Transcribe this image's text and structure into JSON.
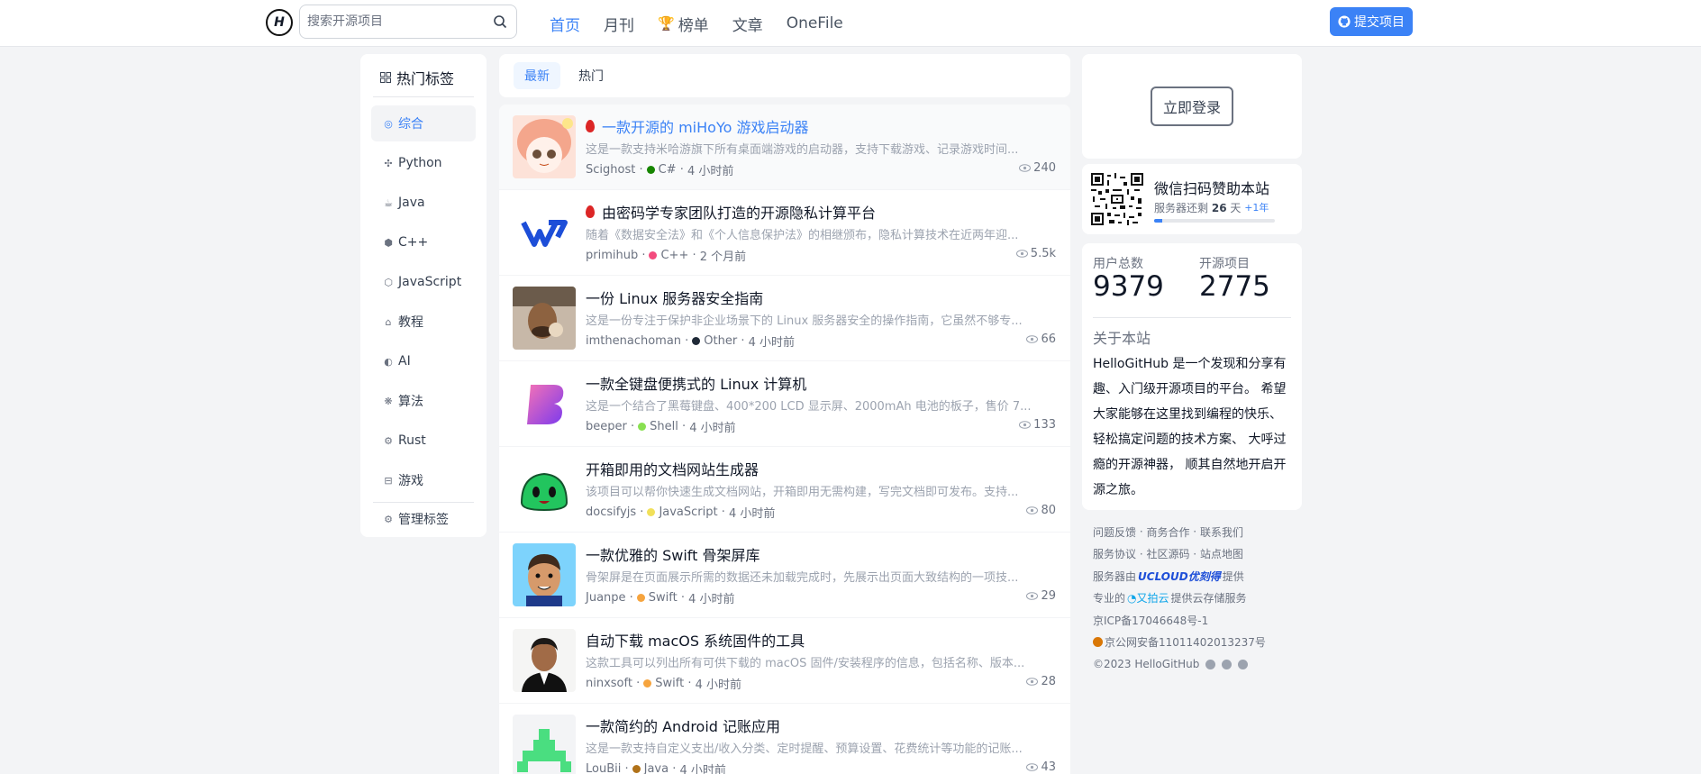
{
  "header": {
    "logo_text": "H",
    "search_placeholder": "搜索开源项目",
    "nav": [
      {
        "label": "首页"
      },
      {
        "label": "月刊"
      },
      {
        "label": "榜单"
      },
      {
        "label": "文章"
      },
      {
        "label": "OneFile"
      }
    ],
    "submit_label": "提交项目"
  },
  "sidebar": {
    "title": "热门标签",
    "tags": [
      {
        "label": "综合",
        "icon": "compass-icon"
      },
      {
        "label": "Python",
        "icon": "python-icon"
      },
      {
        "label": "Java",
        "icon": "java-icon"
      },
      {
        "label": "C++",
        "icon": "cpp-icon"
      },
      {
        "label": "JavaScript",
        "icon": "javascript-icon"
      },
      {
        "label": "教程",
        "icon": "graduation-cap-icon"
      },
      {
        "label": "AI",
        "icon": "ai-icon"
      },
      {
        "label": "算法",
        "icon": "algorithm-icon"
      },
      {
        "label": "Rust",
        "icon": "rust-icon"
      },
      {
        "label": "游戏",
        "icon": "gamepad-icon"
      }
    ],
    "manage_label": "管理标签"
  },
  "tabs": [
    {
      "label": "最新"
    },
    {
      "label": "热门"
    }
  ],
  "projects": [
    {
      "title": "一款开源的 miHoYo 游戏启动器",
      "hot": true,
      "desc": "这是一款支持米哈游旗下所有桌面端游戏的启动器，支持下载游戏、记录游戏时间...",
      "author": "Scighost",
      "lang": "C#",
      "lang_color": "#178600",
      "time": "4 小时前",
      "views": "240"
    },
    {
      "title": "由密码学专家团队打造的开源隐私计算平台",
      "hot": true,
      "desc": "随着《数据安全法》和《个人信息保护法》的相继颁布，隐私计算技术在近两年迎...",
      "author": "primihub",
      "lang": "C++",
      "lang_color": "#f34b7d",
      "time": "2 个月前",
      "views": "5.5k"
    },
    {
      "title": "一份 Linux 服务器安全指南",
      "hot": false,
      "desc": "这是一份专注于保护非企业场景下的 Linux 服务器安全的操作指南，它虽然不够专...",
      "author": "imthenachoman",
      "lang": "Other",
      "lang_color": "#1f2937",
      "time": "4 小时前",
      "views": "66"
    },
    {
      "title": "一款全键盘便携式的 Linux 计算机",
      "hot": false,
      "desc": "这是一个结合了黑莓键盘、400*200 LCD 显示屏、2000mAh 电池的板子，售价 7...",
      "author": "beeper",
      "lang": "Shell",
      "lang_color": "#89e051",
      "time": "4 小时前",
      "views": "133"
    },
    {
      "title": "开箱即用的文档网站生成器",
      "hot": false,
      "desc": "该项目可以帮你快速生成文档网站，开箱即用无需构建，写完文档即可发布。支持...",
      "author": "docsifyjs",
      "lang": "JavaScript",
      "lang_color": "#f1e05a",
      "time": "4 小时前",
      "views": "80"
    },
    {
      "title": "一款优雅的 Swift 骨架屏库",
      "hot": false,
      "desc": "骨架屏是在页面展示所需的数据还未加载完成时，先展示出页面大致结构的一项技...",
      "author": "Juanpe",
      "lang": "Swift",
      "lang_color": "#F05138",
      "time": "4 小时前",
      "views": "29"
    },
    {
      "title": "自动下载 macOS 系统固件的工具",
      "hot": false,
      "desc": "这款工具可以列出所有可供下载的 macOS 固件/安装程序的信息，包括名称、版本...",
      "author": "ninxsoft",
      "lang": "Swift",
      "lang_color": "#F05138",
      "time": "4 小时前",
      "views": "28"
    },
    {
      "title": "一款简约的 Android 记账应用",
      "hot": false,
      "desc": "这是一款支持自定义支出/收入分类、定时提醒、预算设置、花费统计等功能的记账...",
      "author": "LouBii",
      "lang": "Java",
      "lang_color": "#b07219",
      "time": "4 小时前",
      "views": "43"
    }
  ],
  "login": {
    "label": "立即登录"
  },
  "sponsor": {
    "title": "微信扫码赞助本站",
    "prefix": "服务器还剩",
    "days": "26",
    "suffix": "天",
    "plus": "+1年",
    "progress": 0.07
  },
  "stats": {
    "users_label": "用户总数",
    "users_value": "9379",
    "projects_label": "开源项目",
    "projects_value": "2775",
    "about_title": "关于本站",
    "about_text": "HelloGitHub 是一个发现和分享有趣、入门级开源项目的平台。 希望大家能够在这里找到编程的快乐、 轻松搞定问题的技术方案、 大呼过瘾的开源神器， 顺其自然地开启开源之旅。"
  },
  "footer": {
    "row1": [
      "问题反馈",
      "商务合作",
      "联系我们"
    ],
    "row2": [
      "服务协议",
      "社区源码",
      "站点地图"
    ],
    "server_prefix": "服务器由",
    "server_brand": "UCLOUD优刻得",
    "server_suffix": "提供",
    "storage_prefix": "专业的",
    "storage_brand": "又拍云",
    "storage_suffix": "提供云存储服务",
    "icp": "京ICP备17046648号-1",
    "police": "京公网安备11011402013237号",
    "copyright": "©2023 HelloGitHub"
  }
}
